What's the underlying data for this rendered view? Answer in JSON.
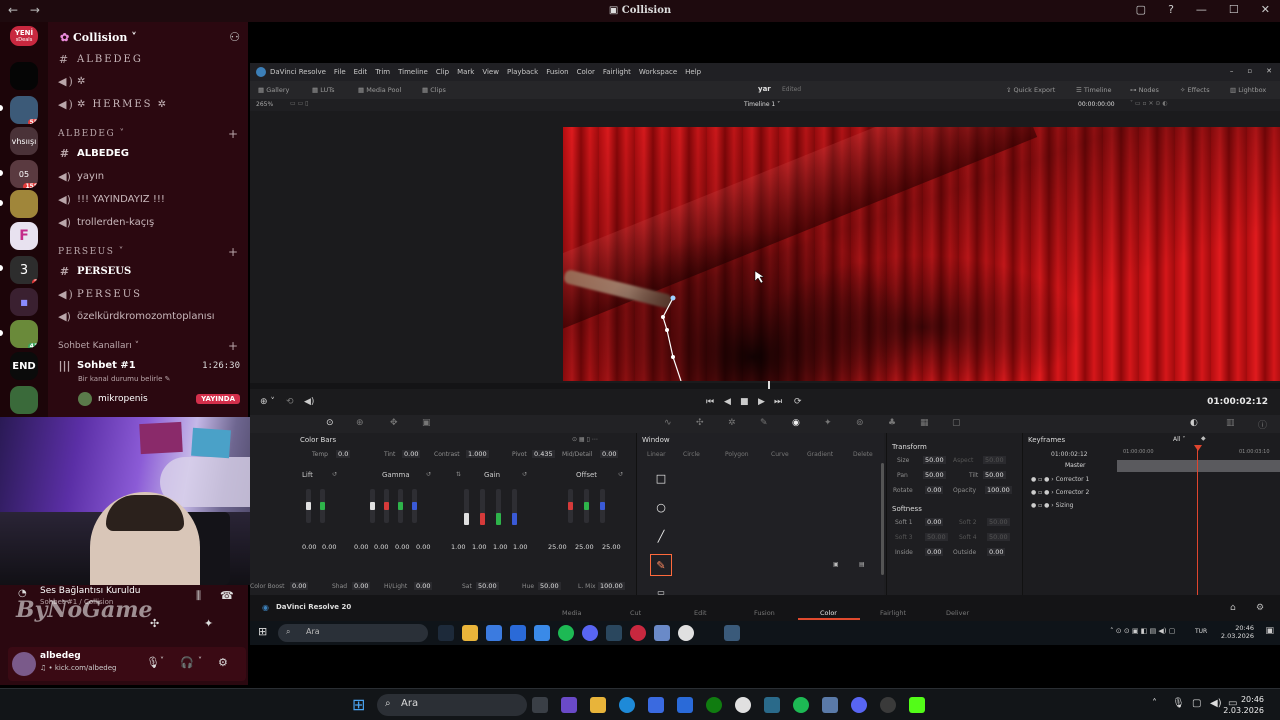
{
  "window": {
    "title": "Collision",
    "back": "←",
    "forward": "→"
  },
  "rail": {
    "new_badge": "YENİ",
    "new_sub": "sDeals",
    "servers": [
      {
        "label": "",
        "badge": "55"
      },
      {
        "label": "vhsıışı",
        "badge": ""
      },
      {
        "label": "05",
        "badge": "158"
      },
      {
        "label": "",
        "badge": ""
      },
      {
        "label": "F",
        "badge": ""
      },
      {
        "label": "3",
        "badge": "2"
      },
      {
        "label": "",
        "badge": ""
      },
      {
        "label": "",
        "badge": "41"
      },
      {
        "label": "END",
        "badge": ""
      },
      {
        "label": "",
        "badge": ""
      }
    ]
  },
  "channels": {
    "server_name": "Collision",
    "top_items": [
      {
        "icon": "hashtag-icon",
        "label": "ALBEDEG",
        "style": "serif"
      },
      {
        "icon": "megaphone-icon",
        "label": "✲",
        "style": "serif"
      },
      {
        "icon": "megaphone-icon",
        "label": "✲ HERMES ✲",
        "style": "serif"
      }
    ],
    "categories": [
      {
        "name": "ALBEDEG",
        "items": [
          {
            "icon": "hashtag-icon",
            "label": "ALBEDEG",
            "selected": true
          },
          {
            "icon": "megaphone-icon",
            "label": "yayın",
            "selected": false
          },
          {
            "icon": "megaphone-icon",
            "label": "!!! YAYINDAYIZ !!!",
            "selected": false
          },
          {
            "icon": "megaphone-icon",
            "label": "trollerden-kaçış",
            "selected": false
          }
        ]
      },
      {
        "name": "PERSEUS",
        "items": [
          {
            "icon": "hashtag-icon",
            "label": "PERSEUS",
            "selected": true
          },
          {
            "icon": "megaphone-icon",
            "label": "PERSEUS",
            "selected": false
          },
          {
            "icon": "megaphone-icon",
            "label": "özelkürdkromozomtoplanısı",
            "selected": false
          }
        ]
      }
    ],
    "voice_category": "Sohbet Kanalları",
    "voice_channel": {
      "name": "Sohbet #1",
      "time": "1:26:30",
      "status": "Bir kanal durumu belirle",
      "member": "mikropenis",
      "live": "YAYINDA"
    }
  },
  "voice_panel": {
    "connected": "Ses Bağlantısı Kuruldu",
    "sub": "Sohbet #1 / Collision",
    "watermark": "ByNoGame",
    "user": "albedeg",
    "user_status": "♫ • kick.com/albedeg"
  },
  "resolve": {
    "menu": [
      "DaVinci Resolve",
      "File",
      "Edit",
      "Trim",
      "Timeline",
      "Clip",
      "Mark",
      "View",
      "Playback",
      "Fusion",
      "Color",
      "Fairlight",
      "Workspace",
      "Help"
    ],
    "toolbar_left": [
      "Gallery",
      "LUTs",
      "Media Pool",
      "Clips"
    ],
    "project": "yar",
    "edited": "Edited",
    "toolbar_right": [
      "Quick Export",
      "Timeline",
      "Nodes",
      "Effects",
      "Lightbox"
    ],
    "zoom": "265%",
    "timeline_name": "Timeline 1",
    "timecode_top": "00:00:00:00",
    "timecode": "01:00:02:12",
    "colorbars": {
      "title": "Color Bars",
      "temp_label": "Temp",
      "temp": "0.0",
      "tint_label": "Tint",
      "tint": "0.00",
      "contrast_label": "Contrast",
      "contrast": "1.000",
      "pivot_label": "Pivot",
      "pivot": "0.435",
      "middetail_label": "Mid/Detail",
      "middetail": "0.00",
      "wheels": [
        {
          "name": "Lift",
          "values": [
            "0.00",
            "0.00",
            "0.00"
          ]
        },
        {
          "name": "Gamma",
          "values": [
            "0.00",
            "0.00",
            "0.00",
            "0.00"
          ]
        },
        {
          "name": "Gain",
          "values": [
            "1.00",
            "1.00",
            "1.00",
            "1.00"
          ]
        },
        {
          "name": "Offset",
          "values": [
            "25.00",
            "25.00",
            "25.00"
          ]
        }
      ],
      "bottom": [
        {
          "label": "Color Boost",
          "value": "0.00"
        },
        {
          "label": "Shad",
          "value": "0.00"
        },
        {
          "label": "Hi/Light",
          "value": "0.00"
        },
        {
          "label": "Sat",
          "value": "50.00"
        },
        {
          "label": "Hue",
          "value": "50.00"
        },
        {
          "label": "L. Mix",
          "value": "100.00"
        }
      ]
    },
    "window_panel": {
      "title": "Window",
      "tabs": [
        "Linear",
        "Circle",
        "Polygon",
        "Curve",
        "Gradient",
        "Delete"
      ]
    },
    "transform": {
      "title": "Transform",
      "rows": [
        {
          "a_label": "Size",
          "a": "50.00",
          "b_label": "Aspect",
          "b": "50.00"
        },
        {
          "a_label": "Pan",
          "a": "50.00",
          "b_label": "Tilt",
          "b": "50.00"
        },
        {
          "a_label": "Rotate",
          "a": "0.00",
          "b_label": "Opacity",
          "b": "100.00"
        }
      ],
      "softness_title": "Softness",
      "soft": [
        {
          "a_label": "Soft 1",
          "a": "0.00",
          "b_label": "Soft 2",
          "b": "50.00"
        },
        {
          "a_label": "Soft 3",
          "a": "50.00",
          "b_label": "Soft 4",
          "b": "50.00"
        },
        {
          "a_label": "Inside",
          "a": "0.00",
          "b_label": "Outside",
          "b": "0.00"
        }
      ]
    },
    "keyframes": {
      "title": "Keyframes",
      "filter": "All",
      "timecode": "01:00:02:12",
      "start": "01:00:00:00",
      "end": "01:00:03:10",
      "master": "Master",
      "rows": [
        "Corrector 1",
        "Corrector 2",
        "Sizing"
      ]
    },
    "app_label": "DaVinci Resolve 20",
    "pages": [
      "Media",
      "Cut",
      "Edit",
      "Fusion",
      "Color",
      "Fairlight",
      "Deliver"
    ],
    "active_page": "Color"
  },
  "inner_taskbar": {
    "search": "Ara",
    "lang": "TUR",
    "time": "20:46",
    "date": "2.03.2026"
  },
  "taskbar": {
    "search": "Ara",
    "time": "20:46",
    "date": "2.03.2026"
  }
}
